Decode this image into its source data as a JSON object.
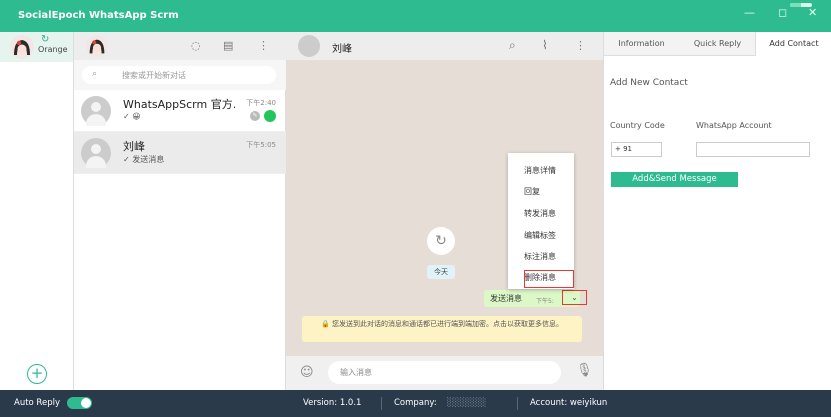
{
  "window": {
    "title": "SocialEpoch WhatsApp Scrm",
    "controls": [
      "—",
      "◻",
      "✕"
    ],
    "update_progress": 0.5
  },
  "accounts": {
    "items": [
      {
        "name": "Orange",
        "refresh_icon": "↻"
      }
    ],
    "add_icon": "+"
  },
  "chats": {
    "header_icons": [
      "◌",
      "▤",
      "⋮"
    ],
    "search_icon": "⌕",
    "search_placeholder": "搜索或开始新对话",
    "items": [
      {
        "name": "WhatsAppScrm 官方…",
        "time": "下午2:40",
        "last": "✓ 😀",
        "unread": true
      },
      {
        "name": "刘峰",
        "time": "下午5:05",
        "last": "✓ 发送消息",
        "selected": true
      }
    ]
  },
  "conversation": {
    "name": "刘峰",
    "header_icons": [
      "⌕",
      "⌇",
      "⋮"
    ],
    "reload_icon": "↻",
    "day_label": "今天",
    "message": {
      "text": "发送消息",
      "time": "下午5:",
      "arrow_icon": "⌄"
    },
    "notice": "🔒 您发送到此对话的消息和通话都已进行端到端加密。点击以获取更多信息。",
    "context_menu": [
      "消息详情",
      "回复",
      "转发消息",
      "编辑标签",
      "标注消息",
      "删除消息"
    ],
    "input_placeholder": "输入消息",
    "emoji_icon": "☺",
    "mic_icon": "🎙"
  },
  "panel": {
    "tabs": [
      "Information",
      "Quick Reply",
      "Add Contact"
    ],
    "active_tab": 2,
    "form_title": "Add New Contact",
    "country_code_label": "Country Code",
    "country_code_value": "+ 91",
    "account_label": "WhatsApp Account",
    "account_value": "",
    "submit_label": "Add&Send Message"
  },
  "status": {
    "auto_reply_label": "Auto Reply",
    "auto_reply_on": true,
    "version_label": "Version: 1.0.1",
    "company_label": "Company:",
    "company_value": "░░░░░░",
    "account_label": "Account: weiyikun"
  },
  "colors": {
    "brand": "#2ebb8f",
    "status_bar": "#2b3a4a",
    "highlight": "#e53935",
    "bubble": "#dcf8c6"
  }
}
